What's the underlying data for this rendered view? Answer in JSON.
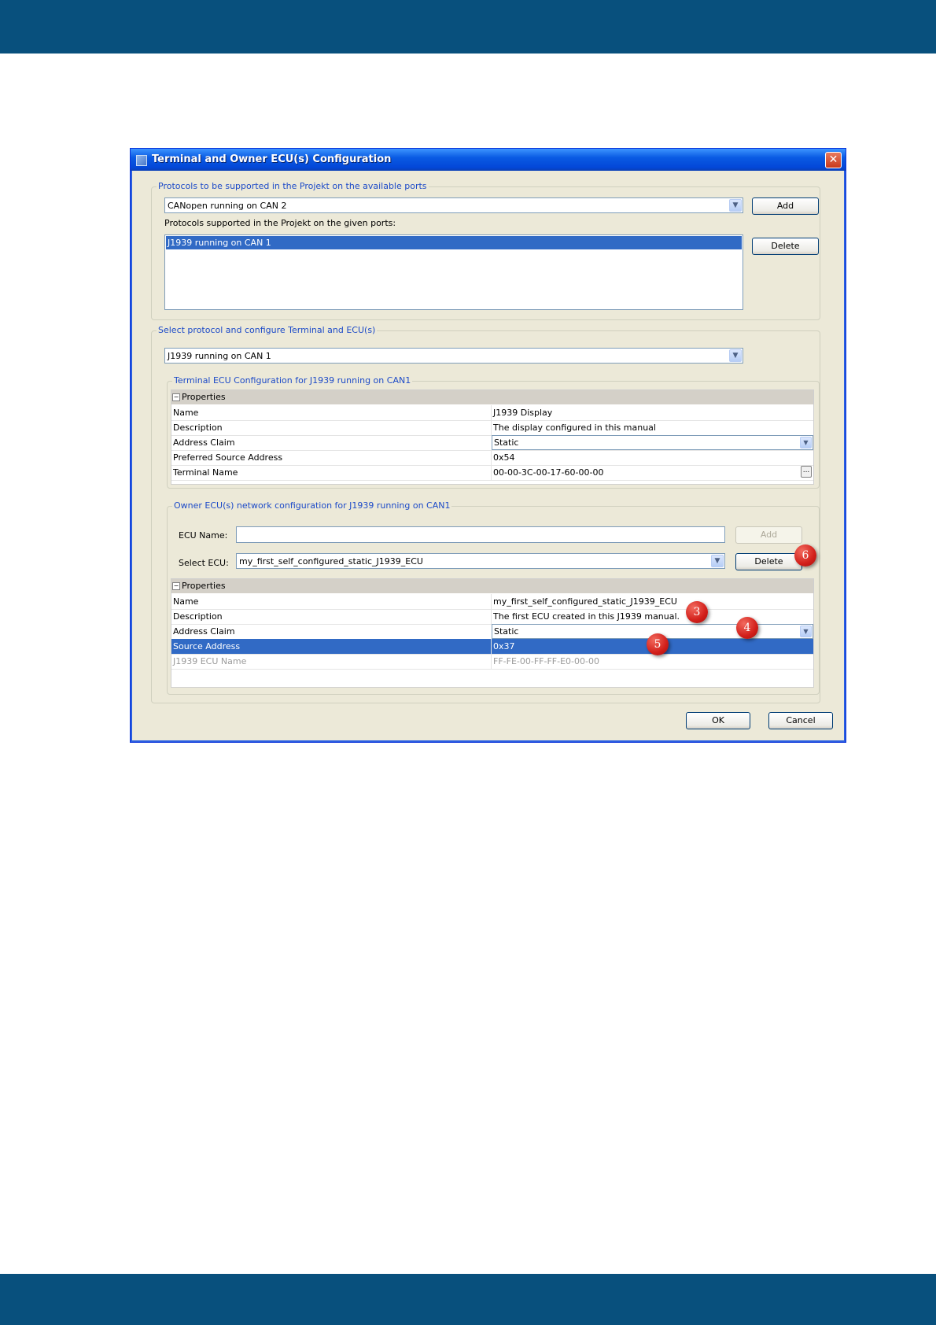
{
  "window": {
    "title": "Terminal and Owner ECU(s) Configuration",
    "close_glyph": "✕"
  },
  "protocols_group": {
    "legend": "Protocols to be supported in the Projekt on the available ports",
    "available_protocol": "CANopen running on CAN 2",
    "add_label": "Add",
    "supported_label": "Protocols supported in the Projekt on the given ports:",
    "supported_items": [
      "J1939 running on CAN 1"
    ],
    "delete_label": "Delete"
  },
  "select_group": {
    "legend": "Select protocol and configure Terminal and ECU(s)",
    "selected_protocol": "J1939 running on CAN 1"
  },
  "terminal_group": {
    "legend": "Terminal ECU Configuration for J1939 running on CAN1",
    "header": "Properties",
    "rows": [
      {
        "key": "Name",
        "value": "J1939 Display"
      },
      {
        "key": "Description",
        "value": "The display configured in this manual"
      },
      {
        "key": "Address Claim",
        "value": "Static"
      },
      {
        "key": "Preferred Source Address",
        "value": "0x54"
      },
      {
        "key": "Terminal Name",
        "value": "00-00-3C-00-17-60-00-00"
      }
    ],
    "ellipsis": "..."
  },
  "owner_group": {
    "legend": "Owner ECU(s) network configuration  for J1939 running on CAN1",
    "ecu_name_label": "ECU Name:",
    "ecu_name_value": "",
    "add_label": "Add",
    "select_ecu_label": "Select ECU:",
    "selected_ecu": "my_first_self_configured_static_J1939_ECU",
    "delete_label": "Delete",
    "header": "Properties",
    "rows": [
      {
        "key": "Name",
        "value": "my_first_self_configured_static_J1939_ECU"
      },
      {
        "key": "Description",
        "value": "The first ECU created in this J1939 manual."
      },
      {
        "key": "Address Claim",
        "value": "Static"
      },
      {
        "key": "Source Address",
        "value": "0x37"
      },
      {
        "key": "J1939 ECU Name",
        "value": "FF-FE-00-FF-FF-E0-00-00"
      }
    ]
  },
  "footer": {
    "ok_label": "OK",
    "cancel_label": "Cancel"
  },
  "markers": [
    "3",
    "4",
    "5",
    "6"
  ],
  "icons": {
    "dropdown": "chevron-down-icon"
  },
  "colors": {
    "header_band": "#08507d",
    "selection": "#316ac5",
    "marker": "#d21f1a",
    "title_bar": "#0a5be3"
  }
}
